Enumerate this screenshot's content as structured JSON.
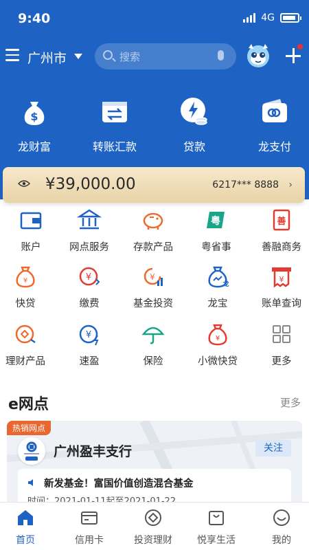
{
  "status": {
    "time": "9:40",
    "network": "4G"
  },
  "header": {
    "city": "广州市",
    "search_placeholder": "搜索"
  },
  "quick_actions": [
    {
      "label": "龙财富",
      "icon": "money-bag-icon"
    },
    {
      "label": "转账汇款",
      "icon": "transfer-icon"
    },
    {
      "label": "贷款",
      "icon": "loan-icon"
    },
    {
      "label": "龙支付",
      "icon": "wallet-pay-icon"
    }
  ],
  "card": {
    "balance": "¥39,000.00",
    "card_number": "6217*** 8888"
  },
  "functions": [
    {
      "label": "账户",
      "icon": "wallet-icon",
      "color": "#1e63c4"
    },
    {
      "label": "网点服务",
      "icon": "bank-building-icon",
      "color": "#1e63c4"
    },
    {
      "label": "存款产品",
      "icon": "piggy-bank-icon",
      "color": "#ee6a2c"
    },
    {
      "label": "粤省事",
      "icon": "yue-icon",
      "color": "#1aa58b"
    },
    {
      "label": "善融商务",
      "icon": "shan-icon",
      "color": "#e33b30"
    },
    {
      "label": "快贷",
      "icon": "fast-loan-icon",
      "color": "#ee6a2c"
    },
    {
      "label": "缴费",
      "icon": "payment-icon",
      "color": "#e33b30"
    },
    {
      "label": "基金投资",
      "icon": "fund-icon",
      "color": "#ee6a2c"
    },
    {
      "label": "龙宝",
      "icon": "dragon-treasure-icon",
      "color": "#1e63c4"
    },
    {
      "label": "账单查询",
      "icon": "bill-query-icon",
      "color": "#e33b30"
    },
    {
      "label": "理财产品",
      "icon": "wealth-product-icon",
      "color": "#ee6a2c"
    },
    {
      "label": "速盈",
      "icon": "quick-profit-icon",
      "color": "#1e63c4"
    },
    {
      "label": "保险",
      "icon": "umbrella-icon",
      "color": "#1aa58b"
    },
    {
      "label": "小微快贷",
      "icon": "micro-loan-icon",
      "color": "#e33b30"
    },
    {
      "label": "更多",
      "icon": "grid-more-icon",
      "color": "#888888"
    }
  ],
  "enet": {
    "title": "e网点",
    "more": "更多",
    "hot_tag": "热销网点",
    "branch_name": "广州盈丰支行",
    "follow": "关注",
    "notice_title": "新发基金！富国价值创造混合基金",
    "notice_date": "时间：2021-01-11起至2021-01-22"
  },
  "tabs": [
    {
      "label": "首页",
      "active": true
    },
    {
      "label": "信用卡",
      "active": false
    },
    {
      "label": "投资理财",
      "active": false
    },
    {
      "label": "悦享生活",
      "active": false
    },
    {
      "label": "我的",
      "active": false
    }
  ],
  "colors": {
    "brand_blue": "#1e63c4",
    "gold_band": "#efdcb6",
    "orange": "#ee6a2c",
    "red": "#e33b30",
    "teal": "#1aa58b"
  }
}
